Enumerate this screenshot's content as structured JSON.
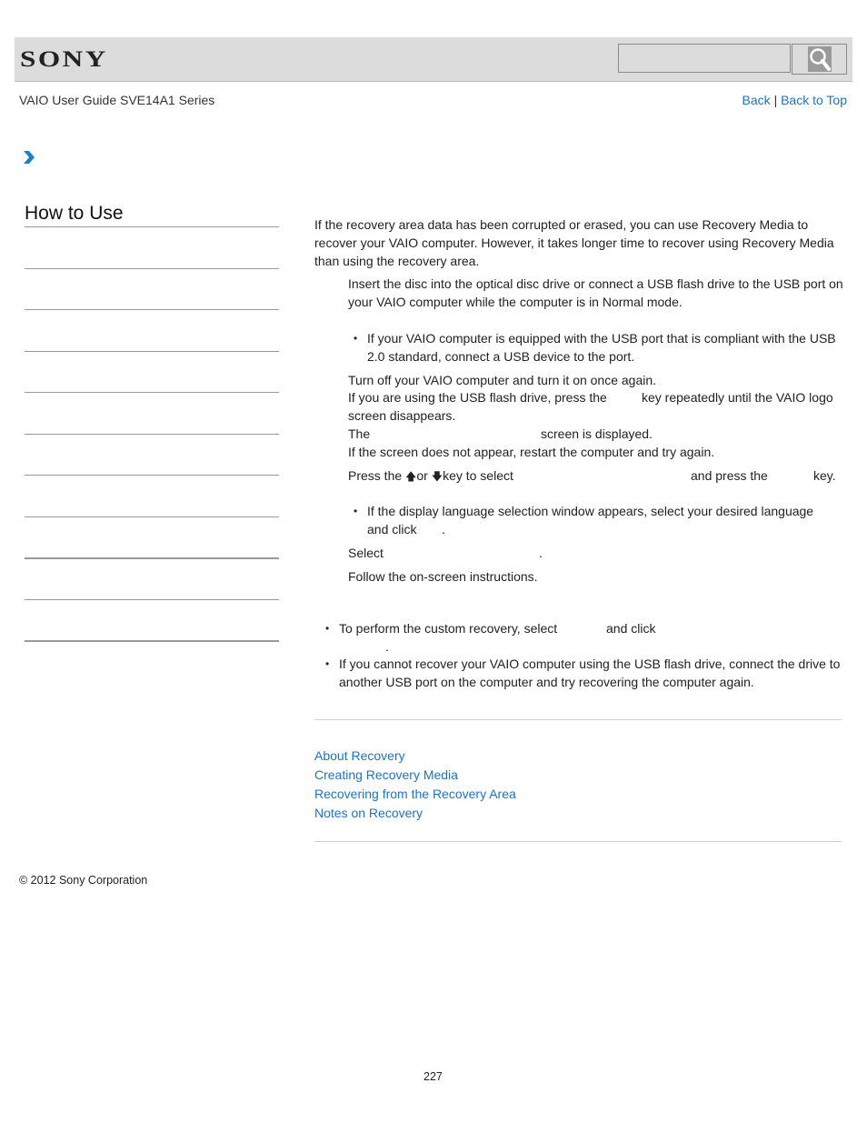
{
  "header": {
    "logo": "SONY",
    "search_placeholder": "",
    "search_icon": "magnifier-icon"
  },
  "subheader": {
    "guide_title": "VAIO User Guide SVE14A1 Series",
    "back_label": "Back",
    "separator": "|",
    "back_to_top_label": "Back to Top"
  },
  "breadcrumb_icon": "chevron-right-icon",
  "sidebar": {
    "title": "How to Use",
    "items": [
      "",
      "",
      "",
      "",
      "",
      "",
      "",
      "",
      "",
      ""
    ]
  },
  "content": {
    "intro": "If the recovery area data has been corrupted or erased, you can use Recovery Media to recover your VAIO computer. However, it takes longer time to recover using Recovery Media than using the recovery area.",
    "step1": "Insert the disc into the optical disc drive or connect a USB flash drive to the USB port on your VAIO computer while the computer is in Normal mode.",
    "step1_note": "If your VAIO computer is equipped with the USB port that is compliant with the USB 2.0 standard, connect a USB device to the port.",
    "step2_line1": "Turn off your VAIO computer and turn it on once again.",
    "step2_line2a": "If you are using the USB flash drive, press the",
    "step2_line2b": "key repeatedly until the VAIO logo",
    "step2_line3": "screen disappears.",
    "step2_line4a": "The",
    "step2_line4b": "screen is displayed.",
    "step2_line5": "If the screen does not appear, restart the computer and try again.",
    "step3_a": "Press the",
    "step3_up": "🡅",
    "step3_or": "or",
    "step3_down": "🡇",
    "step3_b": "key to select",
    "step3_c": "and press the",
    "step3_d": "key.",
    "step3_note_a": "If the display language selection window appears, select your desired language",
    "step3_note_b": "and click",
    "step3_note_c": ".",
    "step4_a": "Select",
    "step4_b": ".",
    "step5": "Follow the on-screen instructions.",
    "hint1_a": "To perform the custom recovery, select",
    "hint1_b": "and click",
    "hint1_c": ".",
    "hint2": "If you cannot recover your VAIO computer using the USB flash drive, connect the drive to another USB port on the computer and try recovering the computer again."
  },
  "related_topics": [
    "About Recovery",
    "Creating Recovery Media",
    "Recovering from the Recovery Area",
    "Notes on Recovery"
  ],
  "footer": {
    "copyright": "© 2012 Sony Corporation",
    "page_number": "227"
  },
  "colors": {
    "link": "#1e73be",
    "header_bg": "#dcdcdc",
    "chevron": "#1e7fc8"
  }
}
